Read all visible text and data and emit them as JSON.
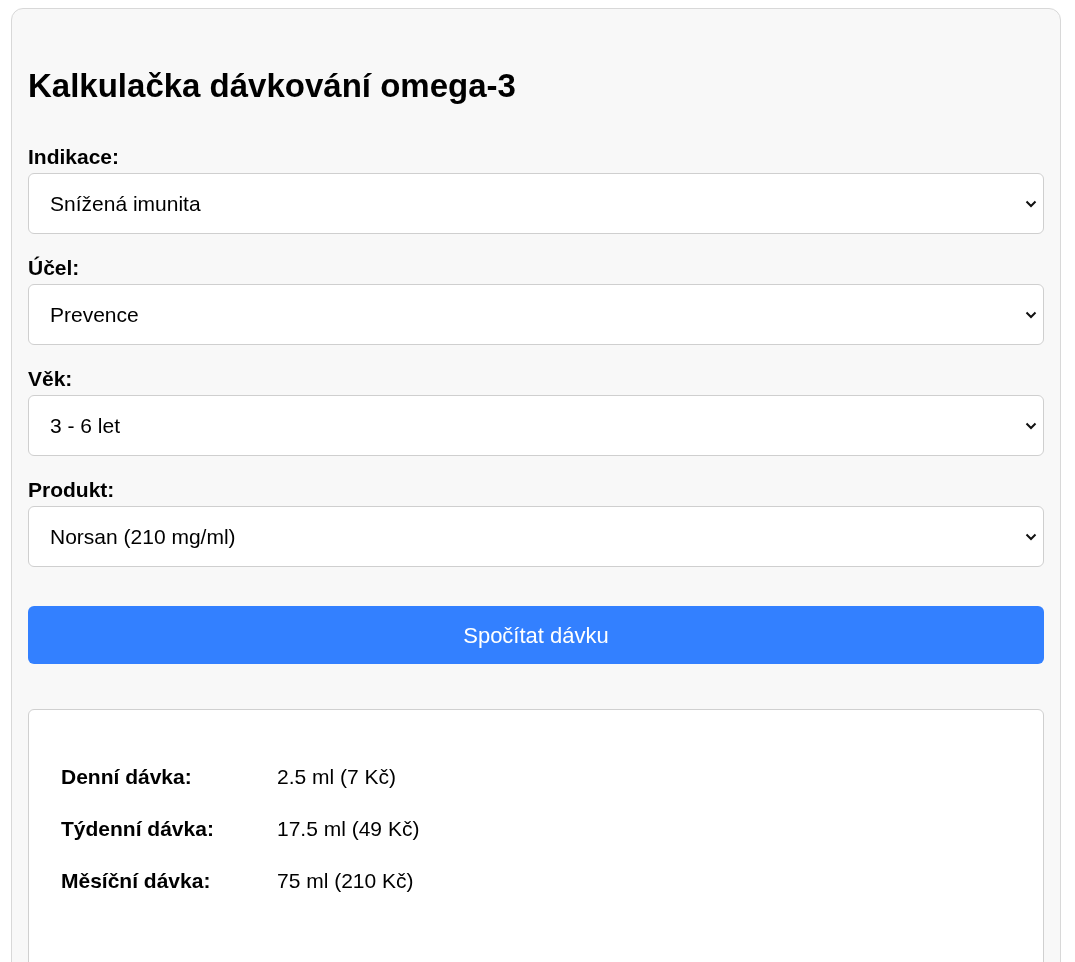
{
  "title": "Kalkulačka dávkování omega-3",
  "fields": [
    {
      "label": "Indikace:",
      "value": "Snížená imunita"
    },
    {
      "label": "Účel:",
      "value": "Prevence"
    },
    {
      "label": "Věk:",
      "value": "3 - 6 let"
    },
    {
      "label": "Produkt:",
      "value": "Norsan (210 mg/ml)"
    }
  ],
  "button": "Spočítat dávku",
  "results": [
    {
      "label": "Denní dávka:",
      "value": "2.5 ml (7 Kč)"
    },
    {
      "label": "Týdenní dávka:",
      "value": "17.5 ml (49 Kč)"
    },
    {
      "label": "Měsíční dávka:",
      "value": "75 ml (210 Kč)"
    }
  ]
}
